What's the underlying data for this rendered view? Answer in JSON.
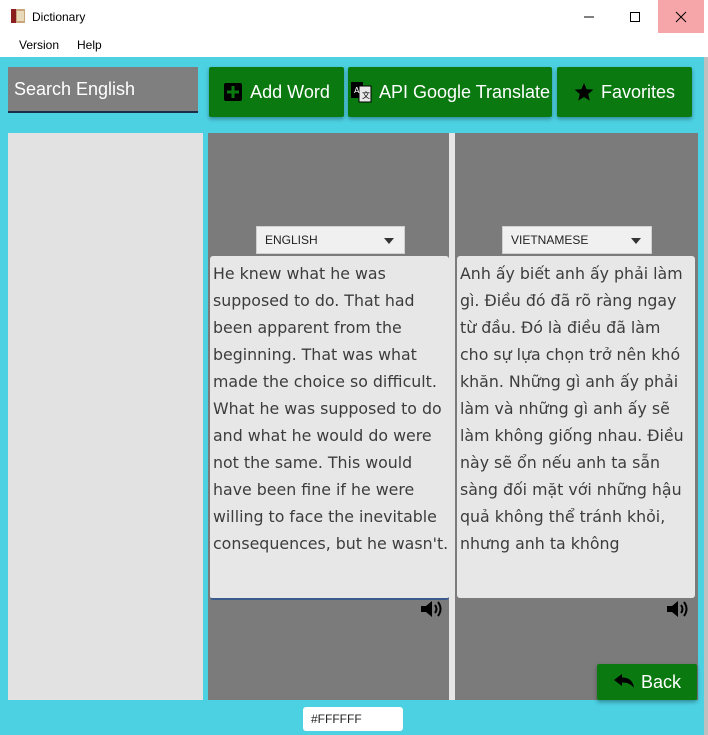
{
  "window": {
    "title": "Dictionary"
  },
  "menu": {
    "items": [
      "Version",
      "Help"
    ]
  },
  "search": {
    "placeholder": "Search English"
  },
  "toolbar": {
    "add_word": "Add Word",
    "api_google_translate": "API Google Translate",
    "favorites": "Favorites"
  },
  "source": {
    "language": "ENGLISH",
    "text": "He knew what he was\nsupposed to do. That had\nbeen apparent from the\nbeginning. That was what\nmade the choice so difficult.\nWhat he was supposed to do\nand what he would do were\nnot the same. This would\nhave been fine if he were\nwilling to face the inevitable\nconsequences, but he wasn't."
  },
  "target": {
    "language": "VIETNAMESE",
    "text": "Anh ấy biết anh ấy phải làm\ngì. Điều đó đã rõ ràng ngay\ntừ đầu. Đó là điều đã làm\ncho sự lựa chọn trở nên khó\nkhăn. Những gì anh ấy phải\nlàm và những gì anh ấy sẽ\nlàm không giống nhau. Điều\nnày sẽ ổn nếu anh ta sẵn\nsàng đối mặt với những hậu\nquả không thể tránh khỏi,\nnhưng anh ta không"
  },
  "back": {
    "label": "Back"
  },
  "color_picker": {
    "value": "#FFFFFF"
  },
  "colors": {
    "background": "#4cd1e3",
    "button_green": "#0a7a10",
    "panel_gray": "#7b7b7b",
    "list_bg": "#e2e2e2"
  },
  "icons": [
    "app-book-icon",
    "minimize-icon",
    "maximize-icon",
    "close-icon",
    "plus-square-icon",
    "translate-icon",
    "star-icon",
    "speaker-icon",
    "back-arrow-icon",
    "chevron-down-icon"
  ]
}
